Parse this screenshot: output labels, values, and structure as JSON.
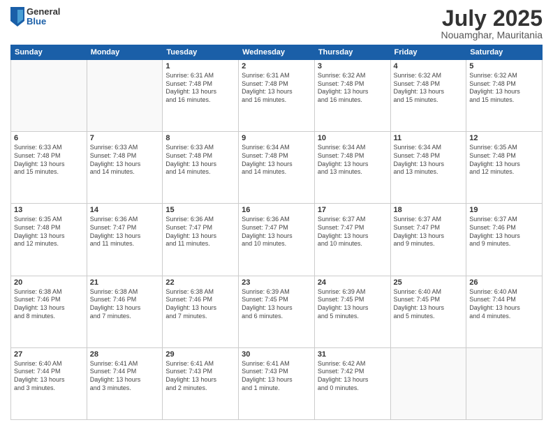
{
  "header": {
    "logo": {
      "general": "General",
      "blue": "Blue"
    },
    "title": "July 2025",
    "location": "Nouamghar, Mauritania"
  },
  "calendar": {
    "headers": [
      "Sunday",
      "Monday",
      "Tuesday",
      "Wednesday",
      "Thursday",
      "Friday",
      "Saturday"
    ],
    "weeks": [
      [
        {
          "day": "",
          "info": ""
        },
        {
          "day": "",
          "info": ""
        },
        {
          "day": "1",
          "info": "Sunrise: 6:31 AM\nSunset: 7:48 PM\nDaylight: 13 hours\nand 16 minutes."
        },
        {
          "day": "2",
          "info": "Sunrise: 6:31 AM\nSunset: 7:48 PM\nDaylight: 13 hours\nand 16 minutes."
        },
        {
          "day": "3",
          "info": "Sunrise: 6:32 AM\nSunset: 7:48 PM\nDaylight: 13 hours\nand 16 minutes."
        },
        {
          "day": "4",
          "info": "Sunrise: 6:32 AM\nSunset: 7:48 PM\nDaylight: 13 hours\nand 15 minutes."
        },
        {
          "day": "5",
          "info": "Sunrise: 6:32 AM\nSunset: 7:48 PM\nDaylight: 13 hours\nand 15 minutes."
        }
      ],
      [
        {
          "day": "6",
          "info": "Sunrise: 6:33 AM\nSunset: 7:48 PM\nDaylight: 13 hours\nand 15 minutes."
        },
        {
          "day": "7",
          "info": "Sunrise: 6:33 AM\nSunset: 7:48 PM\nDaylight: 13 hours\nand 14 minutes."
        },
        {
          "day": "8",
          "info": "Sunrise: 6:33 AM\nSunset: 7:48 PM\nDaylight: 13 hours\nand 14 minutes."
        },
        {
          "day": "9",
          "info": "Sunrise: 6:34 AM\nSunset: 7:48 PM\nDaylight: 13 hours\nand 14 minutes."
        },
        {
          "day": "10",
          "info": "Sunrise: 6:34 AM\nSunset: 7:48 PM\nDaylight: 13 hours\nand 13 minutes."
        },
        {
          "day": "11",
          "info": "Sunrise: 6:34 AM\nSunset: 7:48 PM\nDaylight: 13 hours\nand 13 minutes."
        },
        {
          "day": "12",
          "info": "Sunrise: 6:35 AM\nSunset: 7:48 PM\nDaylight: 13 hours\nand 12 minutes."
        }
      ],
      [
        {
          "day": "13",
          "info": "Sunrise: 6:35 AM\nSunset: 7:48 PM\nDaylight: 13 hours\nand 12 minutes."
        },
        {
          "day": "14",
          "info": "Sunrise: 6:36 AM\nSunset: 7:47 PM\nDaylight: 13 hours\nand 11 minutes."
        },
        {
          "day": "15",
          "info": "Sunrise: 6:36 AM\nSunset: 7:47 PM\nDaylight: 13 hours\nand 11 minutes."
        },
        {
          "day": "16",
          "info": "Sunrise: 6:36 AM\nSunset: 7:47 PM\nDaylight: 13 hours\nand 10 minutes."
        },
        {
          "day": "17",
          "info": "Sunrise: 6:37 AM\nSunset: 7:47 PM\nDaylight: 13 hours\nand 10 minutes."
        },
        {
          "day": "18",
          "info": "Sunrise: 6:37 AM\nSunset: 7:47 PM\nDaylight: 13 hours\nand 9 minutes."
        },
        {
          "day": "19",
          "info": "Sunrise: 6:37 AM\nSunset: 7:46 PM\nDaylight: 13 hours\nand 9 minutes."
        }
      ],
      [
        {
          "day": "20",
          "info": "Sunrise: 6:38 AM\nSunset: 7:46 PM\nDaylight: 13 hours\nand 8 minutes."
        },
        {
          "day": "21",
          "info": "Sunrise: 6:38 AM\nSunset: 7:46 PM\nDaylight: 13 hours\nand 7 minutes."
        },
        {
          "day": "22",
          "info": "Sunrise: 6:38 AM\nSunset: 7:46 PM\nDaylight: 13 hours\nand 7 minutes."
        },
        {
          "day": "23",
          "info": "Sunrise: 6:39 AM\nSunset: 7:45 PM\nDaylight: 13 hours\nand 6 minutes."
        },
        {
          "day": "24",
          "info": "Sunrise: 6:39 AM\nSunset: 7:45 PM\nDaylight: 13 hours\nand 5 minutes."
        },
        {
          "day": "25",
          "info": "Sunrise: 6:40 AM\nSunset: 7:45 PM\nDaylight: 13 hours\nand 5 minutes."
        },
        {
          "day": "26",
          "info": "Sunrise: 6:40 AM\nSunset: 7:44 PM\nDaylight: 13 hours\nand 4 minutes."
        }
      ],
      [
        {
          "day": "27",
          "info": "Sunrise: 6:40 AM\nSunset: 7:44 PM\nDaylight: 13 hours\nand 3 minutes."
        },
        {
          "day": "28",
          "info": "Sunrise: 6:41 AM\nSunset: 7:44 PM\nDaylight: 13 hours\nand 3 minutes."
        },
        {
          "day": "29",
          "info": "Sunrise: 6:41 AM\nSunset: 7:43 PM\nDaylight: 13 hours\nand 2 minutes."
        },
        {
          "day": "30",
          "info": "Sunrise: 6:41 AM\nSunset: 7:43 PM\nDaylight: 13 hours\nand 1 minute."
        },
        {
          "day": "31",
          "info": "Sunrise: 6:42 AM\nSunset: 7:42 PM\nDaylight: 13 hours\nand 0 minutes."
        },
        {
          "day": "",
          "info": ""
        },
        {
          "day": "",
          "info": ""
        }
      ]
    ]
  }
}
